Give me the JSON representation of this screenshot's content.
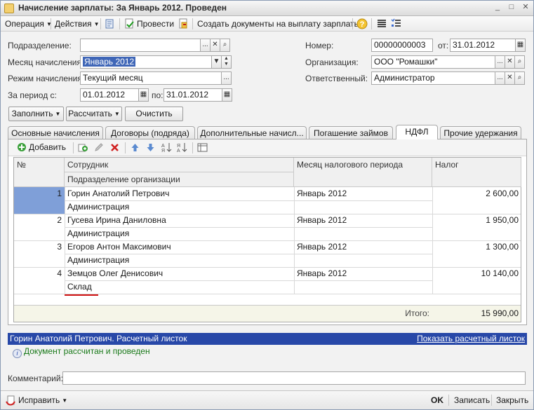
{
  "window": {
    "title": "Начисление зарплаты: За Январь 2012. Проведен"
  },
  "toolbar": {
    "operation": "Операция",
    "actions": "Действия",
    "post": "Провести",
    "create_docs": "Создать документы на выплату зарплаты"
  },
  "form": {
    "subdivision_label": "Подразделение:",
    "subdivision_value": "",
    "month_label": "Месяц начисления:",
    "month_value": "Январь 2012",
    "mode_label": "Режим начисления:",
    "mode_value": "Текущий месяц",
    "period_label": "За период с:",
    "period_from": "01.01.2012",
    "period_to_label": "по:",
    "period_to": "31.01.2012",
    "number_label": "Номер:",
    "number_value": "00000000003",
    "date_label": "от:",
    "date_value": "31.01.2012",
    "org_label": "Организация:",
    "org_value": "ООО \"Ромашки\"",
    "resp_label": "Ответственный:",
    "resp_value": "Администратор"
  },
  "buttons": {
    "fill": "Заполнить",
    "calc": "Рассчитать",
    "clear": "Очистить"
  },
  "tabs": [
    "Основные начисления",
    "Договоры (подряда)",
    "Дополнительные начисл...",
    "Погашение займов",
    "НДФЛ",
    "Прочие удержания"
  ],
  "subtoolbar": {
    "add": "Добавить"
  },
  "grid": {
    "headers": {
      "num": "№",
      "employee": "Сотрудник",
      "subdivision": "Подразделение организации",
      "month": "Месяц налогового периода",
      "tax": "Налог"
    },
    "rows": [
      {
        "num": "1",
        "employee": "Горин Анатолий Петрович",
        "month": "Январь 2012",
        "tax": "2 600,00",
        "subdivision": "Администрация"
      },
      {
        "num": "2",
        "employee": "Гусева Ирина Даниловна",
        "month": "Январь 2012",
        "tax": "1 950,00",
        "subdivision": "Администрация"
      },
      {
        "num": "3",
        "employee": "Егоров Антон Максимович",
        "month": "Январь 2012",
        "tax": "1 300,00",
        "subdivision": "Администрация"
      },
      {
        "num": "4",
        "employee": "Земцов Олег Денисович",
        "month": "Январь 2012",
        "tax": "10 140,00",
        "subdivision": "Склад"
      }
    ],
    "total_label": "Итого:",
    "total_value": "15 990,00"
  },
  "status": {
    "payslip_title": "Горин Анатолий Петрович. Расчетный листок",
    "show_payslip": "Показать расчетный листок",
    "info": "Документ рассчитан и проведен"
  },
  "comment_label": "Комментарий:",
  "comment_value": "",
  "footer": {
    "fix": "Исправить",
    "ok": "OK",
    "save": "Записать",
    "close": "Закрыть"
  },
  "colors": {
    "accent": "#2848a8",
    "selection": "#3f66b7",
    "underline": "#d01010"
  }
}
